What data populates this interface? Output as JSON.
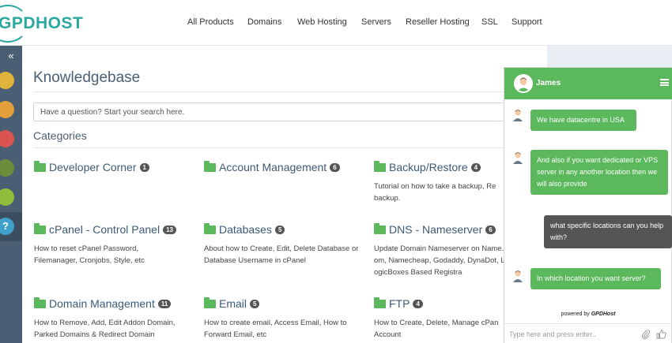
{
  "logo": {
    "text": "GPDHOST"
  },
  "nav": {
    "items": [
      "All Products",
      "Domains",
      "Web Hosting",
      "Servers",
      "Reseller Hosting",
      "SSL",
      "Support"
    ]
  },
  "sidebar": {
    "collapse": "«",
    "icons": [
      "home-icon",
      "monitor-icon",
      "mail-icon",
      "cart-icon",
      "money-icon",
      "help-icon"
    ],
    "colors": [
      "#e0b43a",
      "#e3a03a",
      "#d9534f",
      "#6b8e3a",
      "#8fbf3a",
      "#3fa1c9"
    ]
  },
  "main": {
    "title": "Knowledgebase",
    "search_placeholder": "Have a question? Start your search here.",
    "categories_title": "Categories",
    "categories": [
      {
        "name": "Developer Corner",
        "count": "1",
        "desc": ""
      },
      {
        "name": "Account Management",
        "count": "6",
        "desc": ""
      },
      {
        "name": "Backup/Restore",
        "count": "4",
        "desc": "Tutorial on how to take a backup, Re backup."
      },
      {
        "name": "cPanel - Control Panel",
        "count": "13",
        "desc": "How to reset cPanel Password, Filemanager, Cronjobs, Style, etc"
      },
      {
        "name": "Databases",
        "count": "5",
        "desc": "About how to Create, Edit, Delete Database or Database Username in cPanel"
      },
      {
        "name": "DNS - Nameserver",
        "count": "6",
        "desc": "Update Domain Nameserver on Name.com, Namecheap, Godaddy, DynaDot, LogicBoxes Based Registra"
      },
      {
        "name": "Domain Management",
        "count": "11",
        "desc": "How to Remove, Add, Edit Addon Domain, Parked Domains & Redirect Domain"
      },
      {
        "name": "Email",
        "count": "5",
        "desc": "How to create email, Access Email, How to Forward Email, etc"
      },
      {
        "name": "FTP",
        "count": "4",
        "desc": "How to Create, Delete, Manage cPan Account"
      }
    ]
  },
  "chat": {
    "agent": "James",
    "messages": [
      {
        "from": "agent",
        "text": "We have datacentre in USA"
      },
      {
        "from": "agent",
        "text": "And also if you want dedicated or VPS server in any another location then we will also provide"
      },
      {
        "from": "user",
        "text": "what specific locations can you help with?"
      },
      {
        "from": "agent",
        "text": "In which location you want server?"
      }
    ],
    "powered_prefix": "powered by",
    "powered_brand": "GPDHost",
    "input_placeholder": "Type here and press enter..",
    "colors": {
      "header": "#5cb85c",
      "agent_bubble": "#5cb85c",
      "user_bubble": "#555555"
    }
  }
}
